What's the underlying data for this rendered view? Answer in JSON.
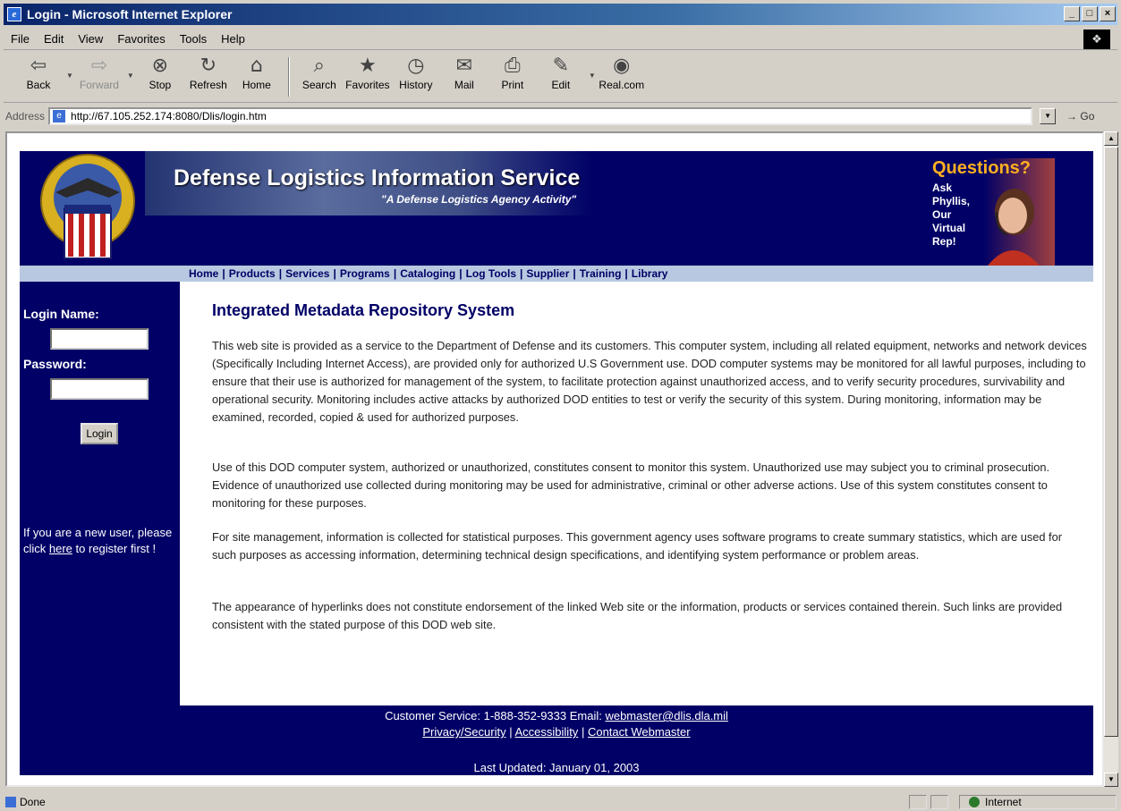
{
  "window": {
    "title": "Login - Microsoft Internet Explorer",
    "controls": [
      "_",
      "□",
      "×"
    ]
  },
  "menu": [
    "File",
    "Edit",
    "View",
    "Favorites",
    "Tools",
    "Help"
  ],
  "toolbar": {
    "back": "Back",
    "forward": "Forward",
    "stop": "Stop",
    "refresh": "Refresh",
    "home": "Home",
    "search": "Search",
    "favorites": "Favorites",
    "history": "History",
    "mail": "Mail",
    "print": "Print",
    "edit": "Edit",
    "realcom": "Real.com"
  },
  "address": {
    "label": "Address",
    "url": "http://67.105.252.174:8080/Dlis/login.htm",
    "go": "Go"
  },
  "banner": {
    "title": "Defense Logistics Information Service",
    "subtitle": "\"A Defense Logistics Agency Activity\"",
    "questions": "Questions?",
    "ask_lines": [
      "Ask",
      "Phyllis,",
      "Our",
      "Virtual",
      "Rep!"
    ]
  },
  "nav": [
    "Home",
    "Products",
    "Services",
    "Programs",
    "Cataloging",
    "Log Tools",
    "Supplier",
    "Training",
    "Library"
  ],
  "login": {
    "name_label": "Login Name:",
    "password_label": "Password:",
    "name_value": "",
    "password_value": "",
    "button": "Login",
    "newuser_pre": "If you are a new user, please click ",
    "newuser_link": "here",
    "newuser_post": " to register first !"
  },
  "content": {
    "heading": "Integrated Metadata Repository System",
    "paragraphs": [
      "This web site is provided as a service to the Department of Defense and its customers. This computer system, including all related equipment, networks and network devices (Specifically Including Internet Access), are provided only for authorized U.S Government use. DOD computer systems may be monitored for all lawful purposes, including to ensure that their use is authorized for management of the system, to facilitate protection against unauthorized access, and to verify security procedures, survivability and operational security. Monitoring includes active attacks by authorized DOD entities to test or verify the security of this system. During monitoring, information may be examined, recorded, copied & used for authorized purposes.",
      "Use of this DOD computer system, authorized or unauthorized, constitutes consent to monitor this system. Unauthorized use may subject you to criminal prosecution. Evidence of unauthorized use collected during monitoring may be used for administrative, criminal or other adverse actions. Use of this system constitutes consent to monitoring for these purposes.",
      "For site management, information is collected for statistical purposes. This government agency uses software programs to create summary statistics, which are used for such purposes as accessing information, determining technical design specifications, and identifying system performance or problem areas.",
      "The appearance of hyperlinks does not constitute endorsement of the linked Web site or the information, products or services contained therein. Such links are provided consistent with the stated purpose of this DOD web site."
    ]
  },
  "footer": {
    "customer_service": "Customer Service: 1-888-352-9333 Email: ",
    "email": "webmaster@dlis.dla.mil",
    "privacy": "Privacy/Security",
    "accessibility": "Accessibility",
    "contact": "Contact Webmaster",
    "sep": "|",
    "updated": "Last Updated: January 01, 2003"
  },
  "status": {
    "text": "Done",
    "zone": "Internet"
  }
}
